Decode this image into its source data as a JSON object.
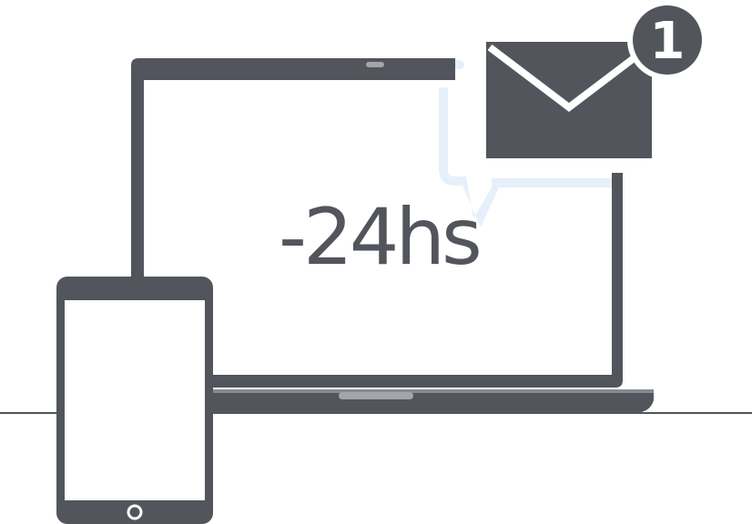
{
  "illustration": {
    "time_label": "-24hs",
    "notification_count": "1",
    "colors": {
      "device": "#53555d",
      "highlight": "#e6f0fa",
      "trackpad": "#a3a5aa",
      "screen": "#ffffff"
    },
    "icons": [
      "laptop-icon",
      "tablet-icon",
      "envelope-icon",
      "notification-badge"
    ]
  }
}
